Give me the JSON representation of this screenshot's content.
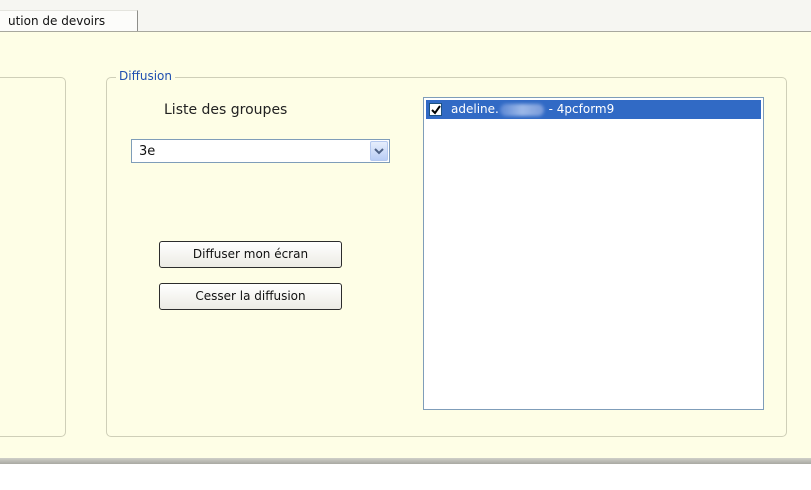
{
  "tab": {
    "label": "ution de devoirs"
  },
  "diffusion": {
    "legend": "Diffusion",
    "groups_title": "Liste des groupes",
    "group_select": {
      "value": "3e"
    },
    "buttons": {
      "start": "Diffuser mon écran",
      "stop": "Cesser la diffusion"
    },
    "students": [
      {
        "name_start": "adeline.",
        "name_end": " - 4pcform9",
        "checked": true,
        "selected": true
      }
    ]
  },
  "colors": {
    "panel_background": "#fefee6",
    "legend_text": "#1f4fb0",
    "selection": "#316ac5"
  }
}
